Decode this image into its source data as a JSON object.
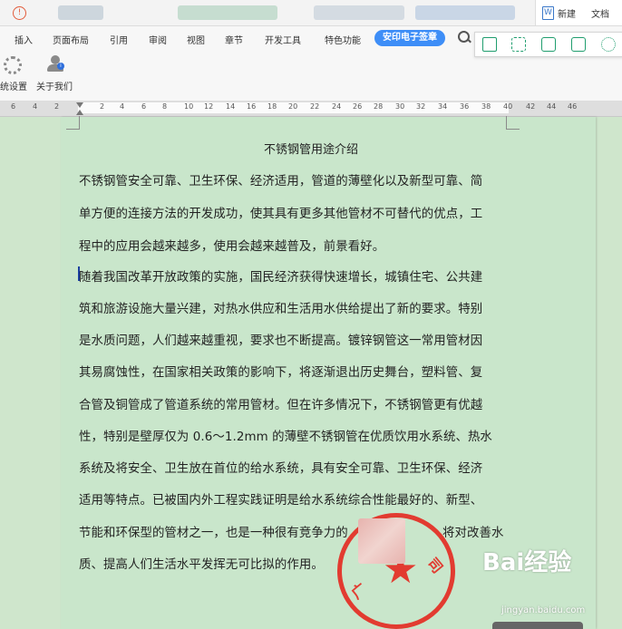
{
  "tab_strip": {
    "badge_icon": "circle-exclamation-icon",
    "document_tab_prefix": "新建",
    "document_tab_suffix": "文档"
  },
  "menu": {
    "items": [
      "插入",
      "页面布局",
      "引用",
      "审阅",
      "视图",
      "章节",
      "开发工具",
      "特色功能"
    ],
    "active": "安印电子签章",
    "search_label": "Q"
  },
  "toolbar": {
    "system_settings": "统设置",
    "about_us": "关于我们"
  },
  "ruler": {
    "numbers": [
      "6",
      "4",
      "2",
      "2",
      "4",
      "6",
      "8",
      "10",
      "12",
      "14",
      "16",
      "18",
      "20",
      "22",
      "24",
      "26",
      "28",
      "30",
      "32",
      "34",
      "36",
      "38",
      "40",
      "42",
      "44",
      "46"
    ]
  },
  "document": {
    "title": "不锈钢管用途介绍",
    "lines": [
      "不锈钢管安全可靠、卫生环保、经济适用，管道的薄壁化以及新型可靠、简",
      "单方便的连接方法的开发成功，使其具有更多其他管材不可替代的优点，工",
      "程中的应用会越来越多，使用会越来越普及，前景看好。",
      "随着我国改革开放政策的实施，国民经济获得快速增长，城镇住宅、公共建",
      "筑和旅游设施大量兴建，对热水供应和生活用水供给提出了新的要求。特别",
      "是水质问题，人们越来越重视，要求也不断提高。镀锌钢管这一常用管材因",
      "其易腐蚀性，在国家相关政策的影响下，将逐渐退出历史舞台，塑料管、复",
      "合管及铜管成了管道系统的常用管材。但在许多情况下，不锈钢管更有优越",
      "性，特别是壁厚仅为 0.6～1.2mm 的薄壁不锈钢管在优质饮用水系统、热水",
      "系统及将安全、卫生放在首位的给水系统，具有安全可靠、卫生环保、经济",
      "适用等特点。已被国内外工程实践证明是给水系统综合性能最好的、新型、",
      "节能和环保型的管材之一，也是一种很有竞争力的",
      "质、提高人们生活水平发挥无可比拟的作用。"
    ],
    "line11_tail": "将对改善水"
  },
  "seal": {
    "star": "★",
    "left_char": "广",
    "right_char": "司",
    "color": "#e23b30"
  },
  "watermark": {
    "brand": "Bai经验",
    "url": "jingyan.baidu.com"
  },
  "colors": {
    "page_bg": "#c9e6cb",
    "accent": "#3e8ef7",
    "icon_green": "#1f9d6e"
  }
}
